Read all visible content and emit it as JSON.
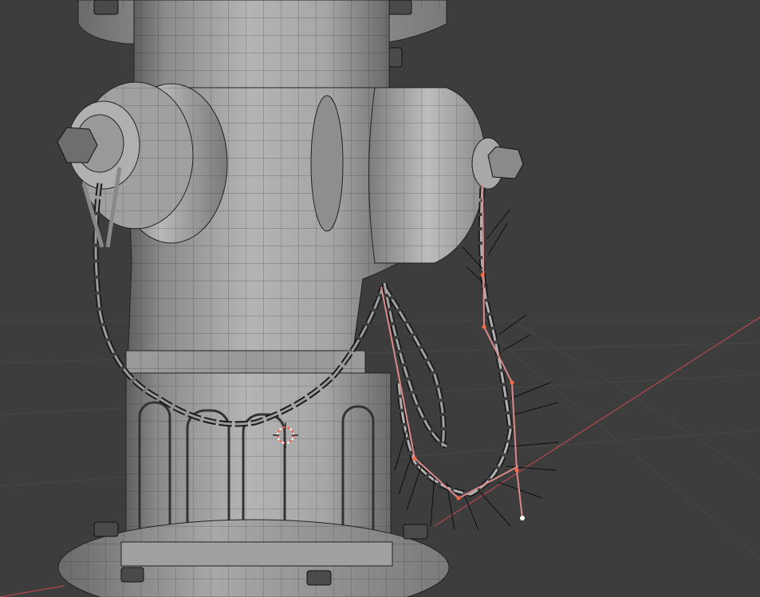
{
  "viewport": {
    "background": "#3d3d3d",
    "grid_color": "#474747",
    "x_axis_color": "#b5474d",
    "mesh_face": "#9a9a9a",
    "mesh_light": "#c4c4c4",
    "mesh_shadow": "#5e5e5e",
    "wire_color": "#1c1c1c",
    "selection_color": "#ff6a3d",
    "hair_guide_color": "#d98a8a",
    "cursor_color": "#ff5c4a"
  },
  "object": {
    "name_icon": "fire-hydrant-mesh",
    "chains": [
      "left-chain",
      "middle-chain",
      "right-chain-selected"
    ],
    "cursor_icon": "3d-cursor-icon",
    "wireframe_overlay": true
  }
}
